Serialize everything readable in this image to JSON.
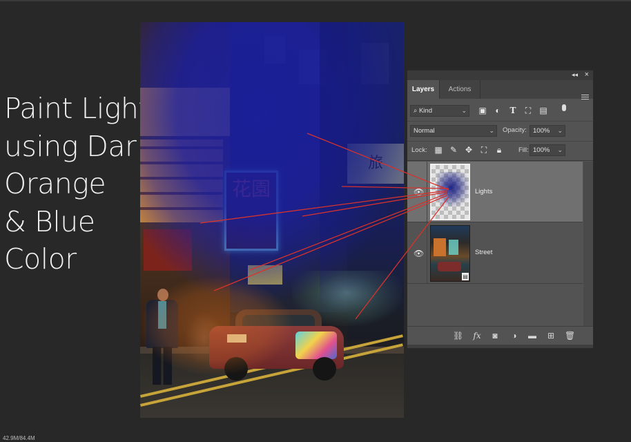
{
  "caption": {
    "lines": [
      "Paint Light",
      "using Dark",
      "Orange",
      "& Blue",
      "Color"
    ]
  },
  "canvas": {
    "neon_sign_text": "花園",
    "right_sign_text": "旅"
  },
  "layers_panel": {
    "tabs": [
      "Layers",
      "Actions"
    ],
    "collapse_icon": "double-chevron-icon",
    "close_icon": "close-icon",
    "filter_kind": "Kind",
    "filter_icons": [
      "image-filter-icon",
      "adjustment-filter-icon",
      "type-filter-icon",
      "shape-filter-icon",
      "smart-object-filter-icon"
    ],
    "blend_mode": "Normal",
    "opacity_label": "Opacity:",
    "opacity_value": "100%",
    "lock_label": "Lock:",
    "fill_label": "Fill:",
    "fill_value": "100%",
    "layers": [
      {
        "name": "Lights",
        "visible": true,
        "selected": true
      },
      {
        "name": "Street",
        "visible": true,
        "selected": false
      }
    ],
    "bottom_icons": [
      "link-icon",
      "fx-icon",
      "mask-icon",
      "adjustment-icon",
      "folder-icon",
      "new-layer-icon",
      "trash-icon"
    ]
  },
  "status_bar": {
    "text": "42.9M/84.4M"
  },
  "colors": {
    "annotation_arrows": "#d8322c",
    "blue_paint": "#1a1ea0",
    "orange_paint": "#dc6e1e"
  }
}
